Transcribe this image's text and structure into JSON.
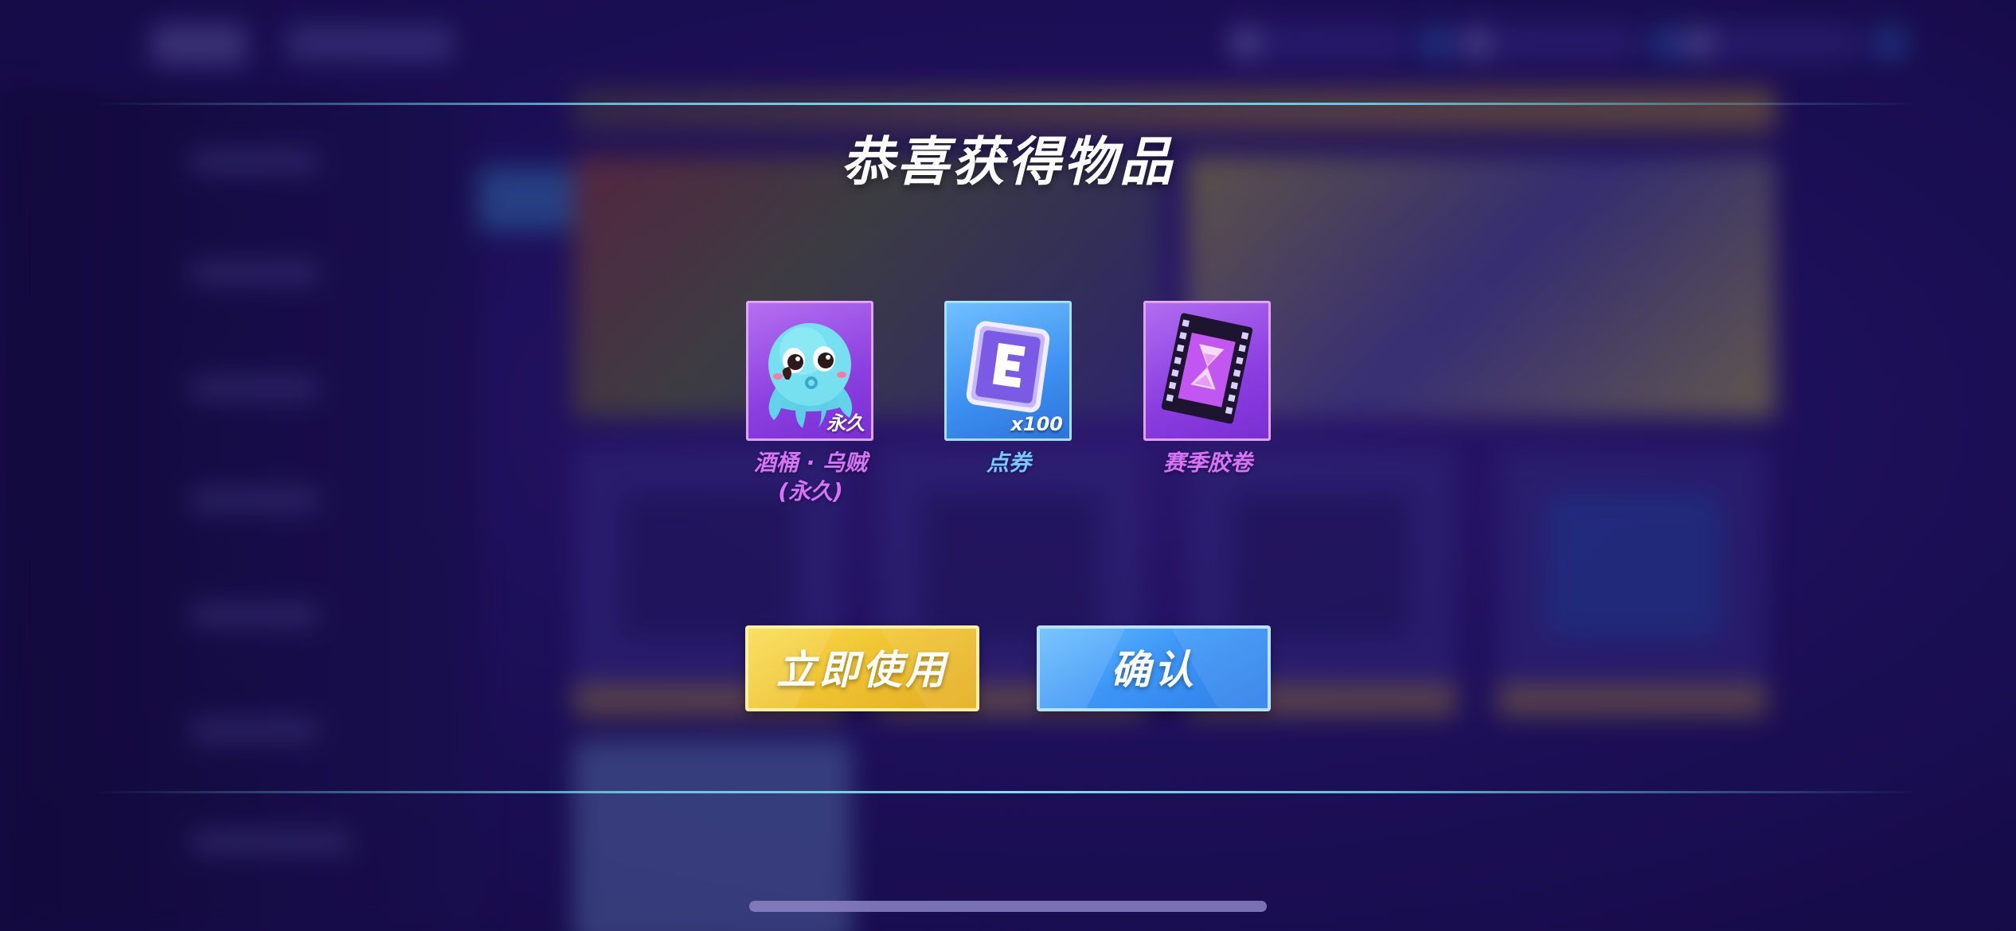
{
  "popup": {
    "title": "恭喜获得物品",
    "rewards": [
      {
        "name_line1": "酒桶 · 乌贼",
        "name_line2": "(永久)",
        "badge": "永久",
        "icon": "octopus-icon",
        "rarity_color": "#d774f5"
      },
      {
        "name_line1": "点券",
        "name_line2": "",
        "badge": "x100",
        "icon": "coupon-e-icon",
        "rarity_color": "#76c8ff"
      },
      {
        "name_line1": "赛季胶卷",
        "name_line2": "",
        "badge": "",
        "icon": "season-film-icon",
        "rarity_color": "#d774f5"
      }
    ],
    "buttons": {
      "use_now": "立即使用",
      "confirm": "确认"
    }
  },
  "colors": {
    "use_button": "#f0c432",
    "confirm_button": "#3d97f6",
    "accent_line": "#82dceb"
  }
}
